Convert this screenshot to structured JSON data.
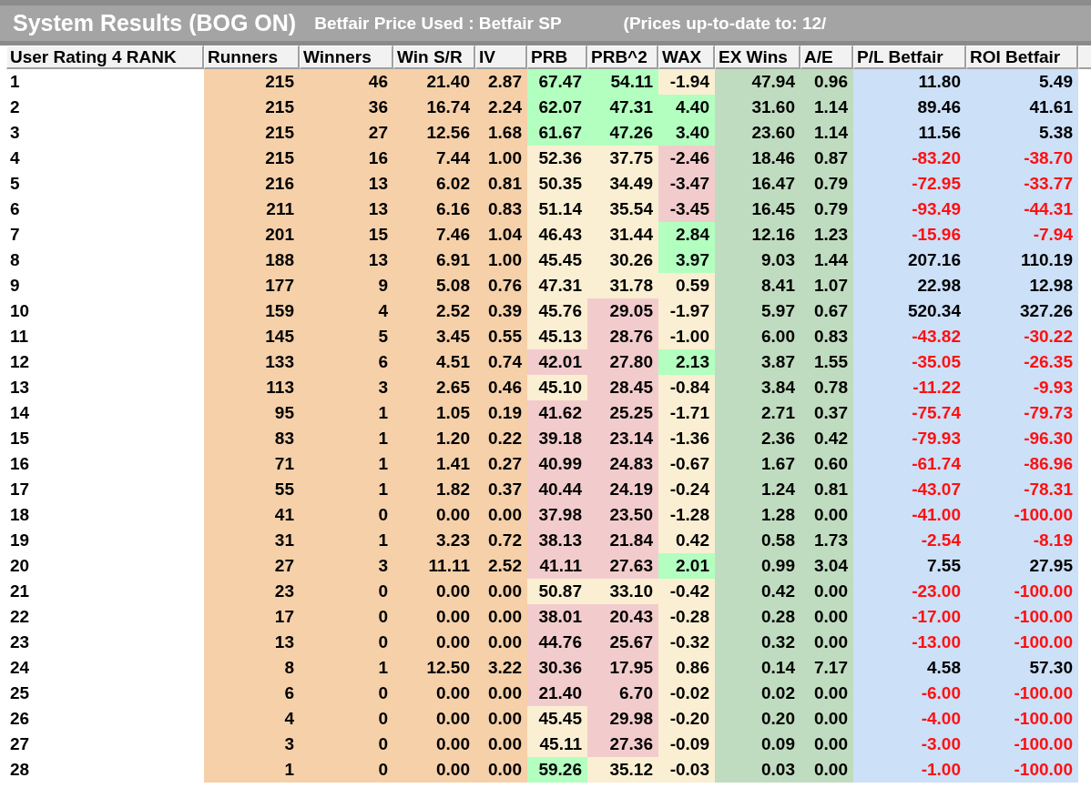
{
  "title": {
    "main": "System Results (BOG ON)",
    "price": "Betfair Price Used : Betfair SP",
    "updated": "(Prices up-to-date to: 12/"
  },
  "columns": [
    {
      "label": "User Rating 4 RANK",
      "kind": "rank"
    },
    {
      "label": "Runners",
      "kind": "count"
    },
    {
      "label": "Winners",
      "kind": "count"
    },
    {
      "label": "Win S/R",
      "kind": "count"
    },
    {
      "label": "IV",
      "kind": "count"
    },
    {
      "label": "PRB",
      "kind": "tone"
    },
    {
      "label": "PRB^2",
      "kind": "tone"
    },
    {
      "label": "WAX",
      "kind": "tone"
    },
    {
      "label": "EX Wins",
      "kind": "expected"
    },
    {
      "label": "A/E",
      "kind": "expected"
    },
    {
      "label": "P/L Betfair",
      "kind": "money"
    },
    {
      "label": "ROI Betfair",
      "kind": "money"
    }
  ],
  "rows": [
    {
      "cells": [
        "1",
        "215",
        "46",
        "21.40",
        "2.87",
        {
          "text": "67.47",
          "color": "#b3ffc0"
        },
        {
          "text": "54.11",
          "color": "#b3ffc0"
        },
        {
          "text": "-1.94",
          "color": "#faefd2"
        },
        "47.94",
        "0.96",
        "11.80",
        "5.49"
      ],
      "loss": false
    },
    {
      "cells": [
        "2",
        "215",
        "36",
        "16.74",
        "2.24",
        {
          "text": "62.07",
          "color": "#b3ffc0"
        },
        {
          "text": "47.31",
          "color": "#b3ffc0"
        },
        {
          "text": "4.40",
          "color": "#b3ffc0"
        },
        "31.60",
        "1.14",
        "89.46",
        "41.61"
      ],
      "loss": false
    },
    {
      "cells": [
        "3",
        "215",
        "27",
        "12.56",
        "1.68",
        {
          "text": "61.67",
          "color": "#b3ffc0"
        },
        {
          "text": "47.26",
          "color": "#b3ffc0"
        },
        {
          "text": "3.40",
          "color": "#b3ffc0"
        },
        "23.60",
        "1.14",
        "11.56",
        "5.38"
      ],
      "loss": false
    },
    {
      "cells": [
        "4",
        "215",
        "16",
        "7.44",
        "1.00",
        {
          "text": "52.36",
          "color": "#faefd2"
        },
        {
          "text": "37.75",
          "color": "#faefd2"
        },
        {
          "text": "-2.46",
          "color": "#f2cccc"
        },
        "18.46",
        "0.87",
        "-83.20",
        "-38.70"
      ],
      "loss": true
    },
    {
      "cells": [
        "5",
        "216",
        "13",
        "6.02",
        "0.81",
        {
          "text": "50.35",
          "color": "#faefd2"
        },
        {
          "text": "34.49",
          "color": "#faefd2"
        },
        {
          "text": "-3.47",
          "color": "#f2cccc"
        },
        "16.47",
        "0.79",
        "-72.95",
        "-33.77"
      ],
      "loss": true
    },
    {
      "cells": [
        "6",
        "211",
        "13",
        "6.16",
        "0.83",
        {
          "text": "51.14",
          "color": "#faefd2"
        },
        {
          "text": "35.54",
          "color": "#faefd2"
        },
        {
          "text": "-3.45",
          "color": "#f2cccc"
        },
        "16.45",
        "0.79",
        "-93.49",
        "-44.31"
      ],
      "loss": true
    },
    {
      "cells": [
        "7",
        "201",
        "15",
        "7.46",
        "1.04",
        {
          "text": "46.43",
          "color": "#faefd2"
        },
        {
          "text": "31.44",
          "color": "#faefd2"
        },
        {
          "text": "2.84",
          "color": "#b3ffc0"
        },
        "12.16",
        "1.23",
        "-15.96",
        "-7.94"
      ],
      "loss": true
    },
    {
      "cells": [
        "8",
        "188",
        "13",
        "6.91",
        "1.00",
        {
          "text": "45.45",
          "color": "#faefd2"
        },
        {
          "text": "30.26",
          "color": "#faefd2"
        },
        {
          "text": "3.97",
          "color": "#b3ffc0"
        },
        "9.03",
        "1.44",
        "207.16",
        "110.19"
      ],
      "loss": false
    },
    {
      "cells": [
        "9",
        "177",
        "9",
        "5.08",
        "0.76",
        {
          "text": "47.31",
          "color": "#faefd2"
        },
        {
          "text": "31.78",
          "color": "#faefd2"
        },
        {
          "text": "0.59",
          "color": "#faefd2"
        },
        "8.41",
        "1.07",
        "22.98",
        "12.98"
      ],
      "loss": false
    },
    {
      "cells": [
        "10",
        "159",
        "4",
        "2.52",
        "0.39",
        {
          "text": "45.76",
          "color": "#faefd2"
        },
        {
          "text": "29.05",
          "color": "#f2cccc"
        },
        {
          "text": "-1.97",
          "color": "#faefd2"
        },
        "5.97",
        "0.67",
        "520.34",
        "327.26"
      ],
      "loss": false
    },
    {
      "cells": [
        "11",
        "145",
        "5",
        "3.45",
        "0.55",
        {
          "text": "45.13",
          "color": "#faefd2"
        },
        {
          "text": "28.76",
          "color": "#f2cccc"
        },
        {
          "text": "-1.00",
          "color": "#faefd2"
        },
        "6.00",
        "0.83",
        "-43.82",
        "-30.22"
      ],
      "loss": true
    },
    {
      "cells": [
        "12",
        "133",
        "6",
        "4.51",
        "0.74",
        {
          "text": "42.01",
          "color": "#f2cccc"
        },
        {
          "text": "27.80",
          "color": "#f2cccc"
        },
        {
          "text": "2.13",
          "color": "#b3ffc0"
        },
        "3.87",
        "1.55",
        "-35.05",
        "-26.35"
      ],
      "loss": true
    },
    {
      "cells": [
        "13",
        "113",
        "3",
        "2.65",
        "0.46",
        {
          "text": "45.10",
          "color": "#faefd2"
        },
        {
          "text": "28.45",
          "color": "#f2cccc"
        },
        {
          "text": "-0.84",
          "color": "#faefd2"
        },
        "3.84",
        "0.78",
        "-11.22",
        "-9.93"
      ],
      "loss": true
    },
    {
      "cells": [
        "14",
        "95",
        "1",
        "1.05",
        "0.19",
        {
          "text": "41.62",
          "color": "#f2cccc"
        },
        {
          "text": "25.25",
          "color": "#f2cccc"
        },
        {
          "text": "-1.71",
          "color": "#faefd2"
        },
        "2.71",
        "0.37",
        "-75.74",
        "-79.73"
      ],
      "loss": true
    },
    {
      "cells": [
        "15",
        "83",
        "1",
        "1.20",
        "0.22",
        {
          "text": "39.18",
          "color": "#f2cccc"
        },
        {
          "text": "23.14",
          "color": "#f2cccc"
        },
        {
          "text": "-1.36",
          "color": "#faefd2"
        },
        "2.36",
        "0.42",
        "-79.93",
        "-96.30"
      ],
      "loss": true
    },
    {
      "cells": [
        "16",
        "71",
        "1",
        "1.41",
        "0.27",
        {
          "text": "40.99",
          "color": "#f2cccc"
        },
        {
          "text": "24.83",
          "color": "#f2cccc"
        },
        {
          "text": "-0.67",
          "color": "#faefd2"
        },
        "1.67",
        "0.60",
        "-61.74",
        "-86.96"
      ],
      "loss": true
    },
    {
      "cells": [
        "17",
        "55",
        "1",
        "1.82",
        "0.37",
        {
          "text": "40.44",
          "color": "#f2cccc"
        },
        {
          "text": "24.19",
          "color": "#f2cccc"
        },
        {
          "text": "-0.24",
          "color": "#faefd2"
        },
        "1.24",
        "0.81",
        "-43.07",
        "-78.31"
      ],
      "loss": true
    },
    {
      "cells": [
        "18",
        "41",
        "0",
        "0.00",
        "0.00",
        {
          "text": "37.98",
          "color": "#f2cccc"
        },
        {
          "text": "23.50",
          "color": "#f2cccc"
        },
        {
          "text": "-1.28",
          "color": "#faefd2"
        },
        "1.28",
        "0.00",
        "-41.00",
        "-100.00"
      ],
      "loss": true
    },
    {
      "cells": [
        "19",
        "31",
        "1",
        "3.23",
        "0.72",
        {
          "text": "38.13",
          "color": "#f2cccc"
        },
        {
          "text": "21.84",
          "color": "#f2cccc"
        },
        {
          "text": "0.42",
          "color": "#faefd2"
        },
        "0.58",
        "1.73",
        "-2.54",
        "-8.19"
      ],
      "loss": true
    },
    {
      "cells": [
        "20",
        "27",
        "3",
        "11.11",
        "2.52",
        {
          "text": "41.11",
          "color": "#f2cccc"
        },
        {
          "text": "27.63",
          "color": "#f2cccc"
        },
        {
          "text": "2.01",
          "color": "#b3ffc0"
        },
        "0.99",
        "3.04",
        "7.55",
        "27.95"
      ],
      "loss": false
    },
    {
      "cells": [
        "21",
        "23",
        "0",
        "0.00",
        "0.00",
        {
          "text": "50.87",
          "color": "#faefd2"
        },
        {
          "text": "33.10",
          "color": "#faefd2"
        },
        {
          "text": "-0.42",
          "color": "#faefd2"
        },
        "0.42",
        "0.00",
        "-23.00",
        "-100.00"
      ],
      "loss": true
    },
    {
      "cells": [
        "22",
        "17",
        "0",
        "0.00",
        "0.00",
        {
          "text": "38.01",
          "color": "#f2cccc"
        },
        {
          "text": "20.43",
          "color": "#f2cccc"
        },
        {
          "text": "-0.28",
          "color": "#faefd2"
        },
        "0.28",
        "0.00",
        "-17.00",
        "-100.00"
      ],
      "loss": true
    },
    {
      "cells": [
        "23",
        "13",
        "0",
        "0.00",
        "0.00",
        {
          "text": "44.76",
          "color": "#f2cccc"
        },
        {
          "text": "25.67",
          "color": "#f2cccc"
        },
        {
          "text": "-0.32",
          "color": "#faefd2"
        },
        "0.32",
        "0.00",
        "-13.00",
        "-100.00"
      ],
      "loss": true
    },
    {
      "cells": [
        "24",
        "8",
        "1",
        "12.50",
        "3.22",
        {
          "text": "30.36",
          "color": "#f2cccc"
        },
        {
          "text": "17.95",
          "color": "#f2cccc"
        },
        {
          "text": "0.86",
          "color": "#faefd2"
        },
        "0.14",
        "7.17",
        "4.58",
        "57.30"
      ],
      "loss": false
    },
    {
      "cells": [
        "25",
        "6",
        "0",
        "0.00",
        "0.00",
        {
          "text": "21.40",
          "color": "#f2cccc"
        },
        {
          "text": "6.70",
          "color": "#f2cccc"
        },
        {
          "text": "-0.02",
          "color": "#faefd2"
        },
        "0.02",
        "0.00",
        "-6.00",
        "-100.00"
      ],
      "loss": true
    },
    {
      "cells": [
        "26",
        "4",
        "0",
        "0.00",
        "0.00",
        {
          "text": "45.45",
          "color": "#faefd2"
        },
        {
          "text": "29.98",
          "color": "#f2cccc"
        },
        {
          "text": "-0.20",
          "color": "#faefd2"
        },
        "0.20",
        "0.00",
        "-4.00",
        "-100.00"
      ],
      "loss": true
    },
    {
      "cells": [
        "27",
        "3",
        "0",
        "0.00",
        "0.00",
        {
          "text": "45.11",
          "color": "#faefd2"
        },
        {
          "text": "27.36",
          "color": "#f2cccc"
        },
        {
          "text": "-0.09",
          "color": "#faefd2"
        },
        "0.09",
        "0.00",
        "-3.00",
        "-100.00"
      ],
      "loss": true
    },
    {
      "cells": [
        "28",
        "1",
        "0",
        "0.00",
        "0.00",
        {
          "text": "59.26",
          "color": "#b3ffc0"
        },
        {
          "text": "35.12",
          "color": "#faefd2"
        },
        {
          "text": "-0.03",
          "color": "#faefd2"
        },
        "0.03",
        "0.00",
        "-1.00",
        "-100.00"
      ],
      "loss": true
    }
  ]
}
